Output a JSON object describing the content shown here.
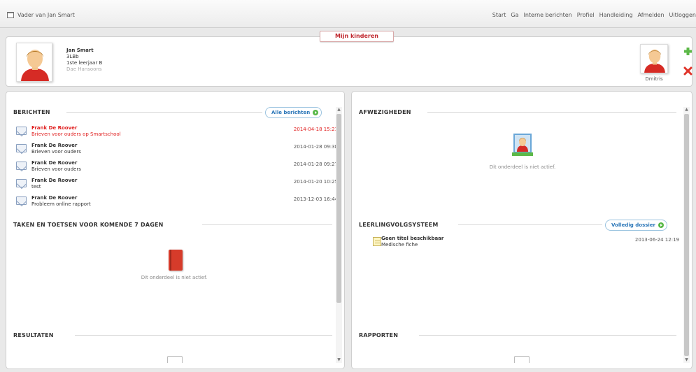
{
  "window": {
    "title": "Vader van Jan Smart"
  },
  "topnav": [
    "Start",
    "Ga",
    "Interne berichten",
    "Profiel",
    "Handleiding",
    "Afmelden",
    "Uitloggen"
  ],
  "tab_label": "Mijn kinderen",
  "child": {
    "name": "Jan Smart",
    "class": "3LBb",
    "year": "1ste leerjaar B",
    "teacher": "Dae Hansoons"
  },
  "sibling": {
    "name": "Dmitris"
  },
  "berichten": {
    "heading": "BERICHTEN",
    "all_button": "Alle berichten",
    "messages": [
      {
        "from": "Frank De Roover",
        "subject": "Brieven voor ouders op Smartschool",
        "date": "2014-04-18 15:21",
        "unread": true
      },
      {
        "from": "Frank De Roover",
        "subject": "Brieven voor ouders",
        "date": "2014-01-28 09:38",
        "unread": false
      },
      {
        "from": "Frank De Roover",
        "subject": "Brieven voor ouders",
        "date": "2014-01-28 09:27",
        "unread": false
      },
      {
        "from": "Frank De Roover",
        "subject": "test",
        "date": "2014-01-20 10:25",
        "unread": false
      },
      {
        "from": "Frank De Roover",
        "subject": "Probleem online rapport",
        "date": "2013-12-03 16:44",
        "unread": false
      }
    ]
  },
  "taken": {
    "heading": "TAKEN EN TOETSEN VOOR KOMENDE 7 DAGEN",
    "inactive_text": "Dit onderdeel is niet actief."
  },
  "resultaten": {
    "heading": "RESULTATEN"
  },
  "afwezigheden": {
    "heading": "AFWEZIGHEDEN",
    "inactive_text": "Dit onderdeel is niet actief."
  },
  "lvs": {
    "heading": "LEERLINGVOLGSYSTEEM",
    "button": "Volledig dossier",
    "item_title": "Geen titel beschikbaar",
    "item_sub": "Medische fiche",
    "item_date": "2013-06-24 12:19"
  },
  "rapporten": {
    "heading": "RAPPORTEN"
  },
  "colors": {
    "accent_red": "#c0262d",
    "link_blue": "#2a76b8",
    "go_green": "#57b847",
    "unread_red": "#e02020"
  }
}
